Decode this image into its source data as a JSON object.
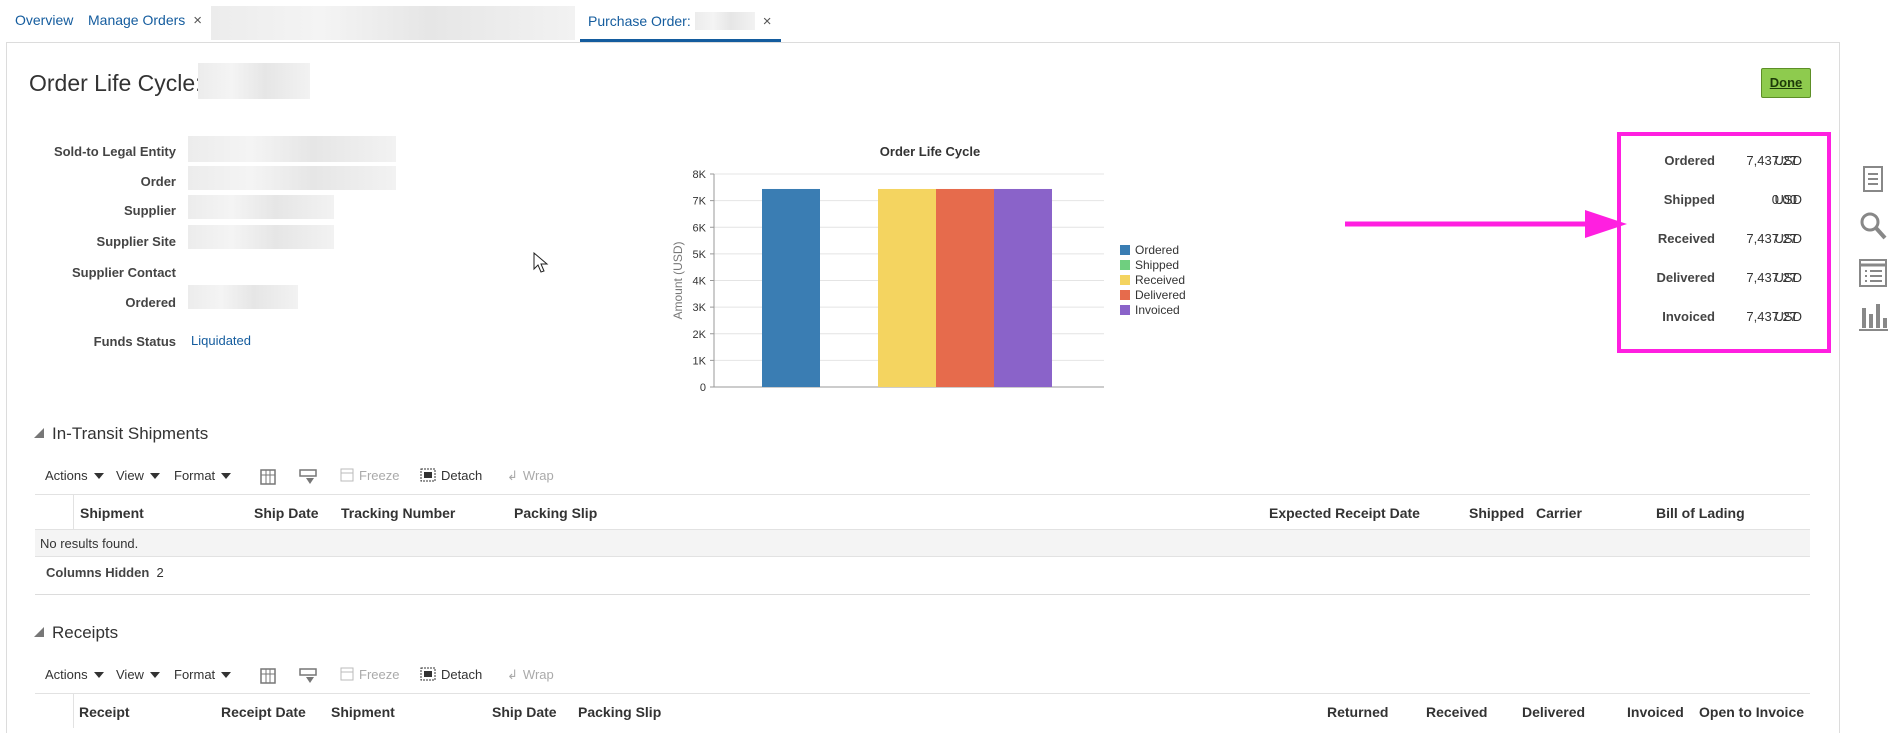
{
  "tabs": [
    {
      "label": "Overview"
    },
    {
      "label": "Manage Orders",
      "close": "×"
    },
    {
      "label": "Purchase Order:",
      "close": "×"
    }
  ],
  "page": {
    "title": "Order Life Cycle:",
    "done_label": "Done"
  },
  "details": {
    "labels": [
      "Sold-to Legal Entity",
      "Order",
      "Supplier",
      "Supplier Site",
      "Supplier Contact",
      "Ordered",
      "Funds Status"
    ],
    "funds_status": "Liquidated"
  },
  "chart_data": {
    "type": "bar",
    "title": "Order Life Cycle",
    "ylabel": "Amount (USD)",
    "xlabel": "",
    "ylim": [
      0,
      8000
    ],
    "yticks": [
      "0",
      "1K",
      "2K",
      "3K",
      "4K",
      "5K",
      "6K",
      "7K",
      "8K"
    ],
    "series": [
      {
        "name": "Ordered",
        "color": "#3a7db3",
        "value": 7437.27
      },
      {
        "name": "Shipped",
        "color": "#6fcf7f",
        "value": 0
      },
      {
        "name": "Received",
        "color": "#f4d460",
        "value": 7437.27
      },
      {
        "name": "Delivered",
        "color": "#e66b4c",
        "value": 7437.27
      },
      {
        "name": "Invoiced",
        "color": "#8a63c9",
        "value": 7437.27
      }
    ],
    "legend_position": "right",
    "grid": true
  },
  "summary": {
    "rows": [
      {
        "label": "Ordered",
        "value": "7,437.27",
        "currency": "USD"
      },
      {
        "label": "Shipped",
        "value": "0.00",
        "currency": "USD"
      },
      {
        "label": "Received",
        "value": "7,437.27",
        "currency": "USD"
      },
      {
        "label": "Delivered",
        "value": "7,437.27",
        "currency": "USD"
      },
      {
        "label": "Invoiced",
        "value": "7,437.27",
        "currency": "USD"
      }
    ],
    "highlight_color": "#ff1fe0"
  },
  "toolbar": {
    "actions": "Actions",
    "view": "View",
    "format": "Format",
    "freeze": "Freeze",
    "detach": "Detach",
    "wrap": "Wrap"
  },
  "in_transit": {
    "title": "In-Transit Shipments",
    "columns": [
      "Shipment",
      "Ship Date",
      "Tracking Number",
      "Packing Slip",
      "Expected Receipt Date",
      "Shipped",
      "Carrier",
      "Bill of Lading"
    ],
    "empty_text": "No results found.",
    "columns_hidden_label": "Columns Hidden",
    "columns_hidden_count": "2"
  },
  "receipts": {
    "title": "Receipts",
    "columns": [
      "Receipt",
      "Receipt Date",
      "Shipment",
      "Ship Date",
      "Packing Slip",
      "Returned",
      "Received",
      "Delivered",
      "Invoiced",
      "Open to Invoice"
    ]
  }
}
